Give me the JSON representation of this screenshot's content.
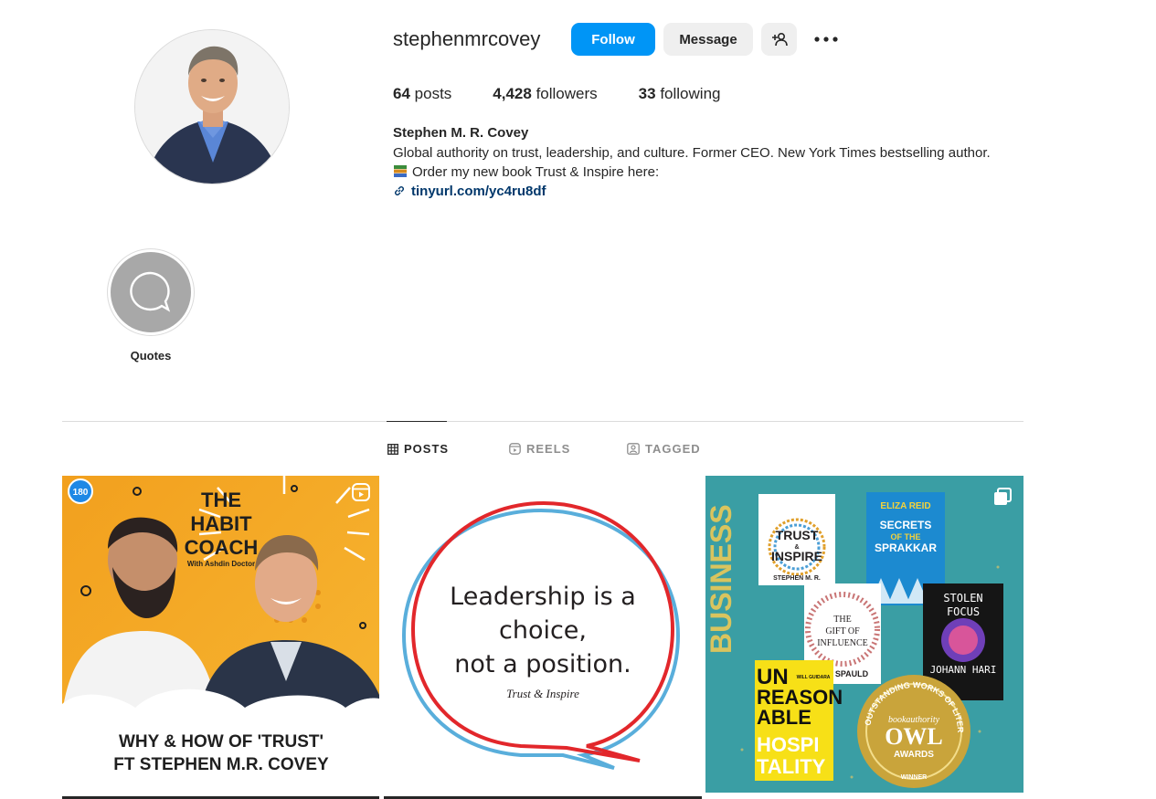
{
  "profile": {
    "username": "stephenmrcovey",
    "follow_label": "Follow",
    "message_label": "Message",
    "stats": {
      "posts_count": "64",
      "posts_label": "posts",
      "followers_count": "4,428",
      "followers_label": "followers",
      "following_count": "33",
      "following_label": "following"
    },
    "full_name": "Stephen M. R. Covey",
    "bio_line1": "Global authority on trust, leadership, and culture. Former CEO. New York Times bestselling author.",
    "bio_line2": "Order my new book Trust & Inspire here:",
    "link": "tinyurl.com/yc4ru8df"
  },
  "highlights": [
    {
      "label": "Quotes"
    }
  ],
  "tabs": {
    "posts": "POSTS",
    "reels": "REELS",
    "tagged": "TAGGED"
  },
  "posts": {
    "post1": {
      "badge": "180",
      "title_line1": "THE",
      "title_line2": "HABIT",
      "title_line3": "COACH",
      "subtitle": "With Ashdin Doctor",
      "caption_line1": "WHY & HOW OF 'TRUST'",
      "caption_line2": "FT STEPHEN M.R. COVEY"
    },
    "post2": {
      "quote_line1": "Leadership is a",
      "quote_line2": "choice,",
      "quote_line3": "not a position.",
      "attribution": "Trust & Inspire"
    },
    "post3": {
      "side_text": "BUSINESS",
      "book1_line1": "TRUST",
      "book1_amp": "&",
      "book1_line2": "INSPIRE",
      "book1_author": "STEPHEN M. R.",
      "book2_author": "ELIZA REID",
      "book2_line1": "SECRETS",
      "book2_line2": "OF THE",
      "book2_line3": "SPRAKKAR",
      "book3_line1": "THE",
      "book3_line2": "GIFT OF",
      "book3_line3": "INFLUENCE",
      "book3_author": "SPAULD",
      "book4_line1": "STOLEN",
      "book4_line2": "FOCUS",
      "book4_author": "JOHANN HARI",
      "book5_line1": "UN",
      "book5_line2": "REASON",
      "book5_line3": "ABLE",
      "book5_line4": "HOSPI",
      "book5_line5": "TALITY",
      "book5_author": "WILL GUIDARA",
      "award_arc": "OUTSTANDING WORKS OF LITERATURE",
      "award_brand": "bookauthority",
      "award_title": "OWL",
      "award_sub": "AWARDS",
      "award_bottom": "WINNER"
    }
  },
  "colors": {
    "follow_blue": "#0095f6",
    "link_blue": "#00376b",
    "secondary_gray": "#8e8e8e",
    "post1_orange": "#f6a623",
    "post3_teal": "#3a9ea4"
  }
}
